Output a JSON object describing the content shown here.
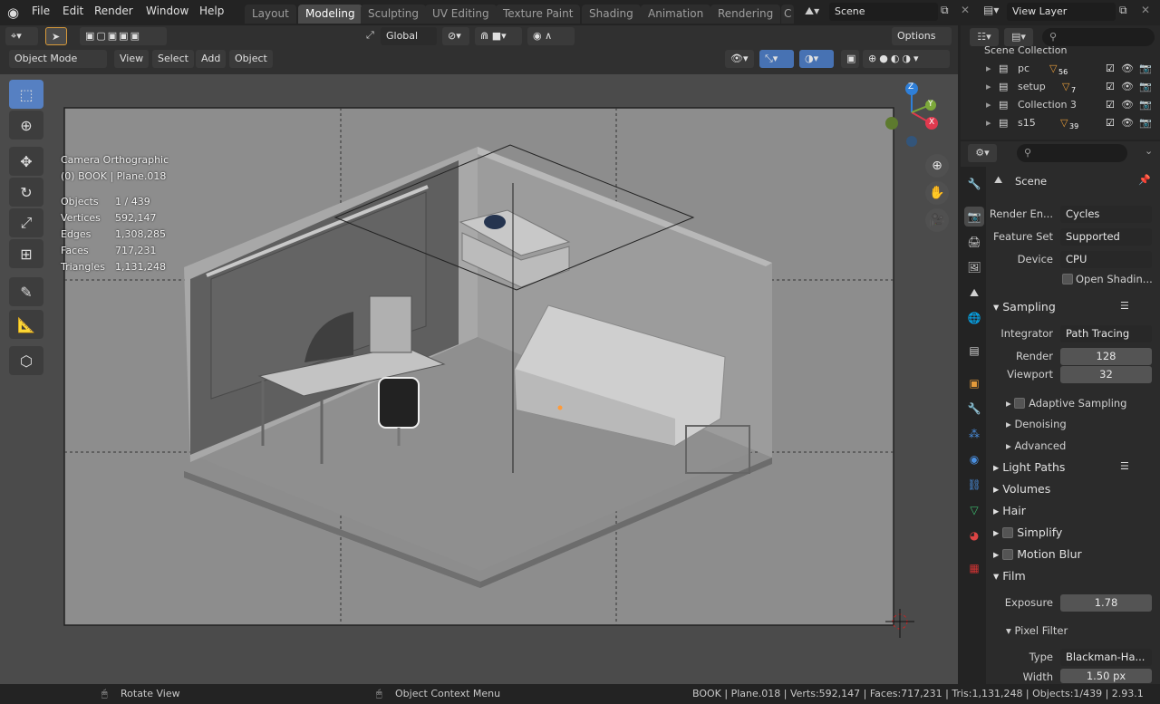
{
  "menu": {
    "file": "File",
    "edit": "Edit",
    "render": "Render",
    "window": "Window",
    "help": "Help"
  },
  "workspaces": [
    "Layout",
    "Modeling",
    "Sculpting",
    "UV Editing",
    "Texture Paint",
    "Shading",
    "Animation",
    "Rendering",
    "C"
  ],
  "active_workspace": "Modeling",
  "scene_field": "Scene",
  "view_layer_field": "View Layer",
  "header": {
    "transform_orientation": "Global",
    "options": "Options",
    "mode": "Object Mode",
    "view": "View",
    "select": "Select",
    "add": "Add",
    "object": "Object"
  },
  "viewport": {
    "camera_label": "Camera Orthographic",
    "object_label": "(0) BOOK | Plane.018",
    "stats": [
      {
        "k": "Objects",
        "v": "1 / 439"
      },
      {
        "k": "Vertices",
        "v": "592,147"
      },
      {
        "k": "Edges",
        "v": "1,308,285"
      },
      {
        "k": "Faces",
        "v": "717,231"
      },
      {
        "k": "Triangles",
        "v": "1,131,248"
      }
    ],
    "gizmo": {
      "x": "X",
      "y": "Y",
      "z": "Z"
    }
  },
  "outliner": {
    "root": "Scene Collection",
    "items": [
      {
        "name": "pc",
        "badge": "56"
      },
      {
        "name": "setup",
        "badge": "7"
      },
      {
        "name": "Collection 3",
        "badge": ""
      },
      {
        "name": "s15",
        "badge": "39"
      }
    ]
  },
  "properties": {
    "context": "Scene",
    "render_engine_label": "Render En...",
    "render_engine": "Cycles",
    "feature_set_label": "Feature Set",
    "feature_set": "Supported",
    "device_label": "Device",
    "device": "CPU",
    "open_shading": "Open Shadin...",
    "sampling": "Sampling",
    "integrator_label": "Integrator",
    "integrator": "Path Tracing",
    "render_label": "Render",
    "render_samples": "128",
    "viewport_label": "Viewport",
    "viewport_samples": "32",
    "adaptive_sampling": "Adaptive Sampling",
    "denoising": "Denoising",
    "advanced": "Advanced",
    "light_paths": "Light Paths",
    "volumes": "Volumes",
    "hair": "Hair",
    "simplify": "Simplify",
    "motion_blur": "Motion Blur",
    "film": "Film",
    "exposure_label": "Exposure",
    "exposure": "1.78",
    "pixel_filter": "Pixel Filter",
    "type_label": "Type",
    "type": "Blackman-Ha...",
    "width_label": "Width",
    "width": "1.50 px"
  },
  "status": {
    "rotate": "Rotate View",
    "context_menu": "Object Context Menu",
    "info": "BOOK | Plane.018 | Verts:592,147 | Faces:717,231 | Tris:1,131,248 | Objects:1/439 | 2.93.1"
  },
  "colors": {
    "accent": "#4772b3",
    "gizmo_x": "#e0394e",
    "gizmo_y": "#7ca83a",
    "gizmo_z": "#2f7fd8",
    "icon_orange": "#e59b3a"
  }
}
